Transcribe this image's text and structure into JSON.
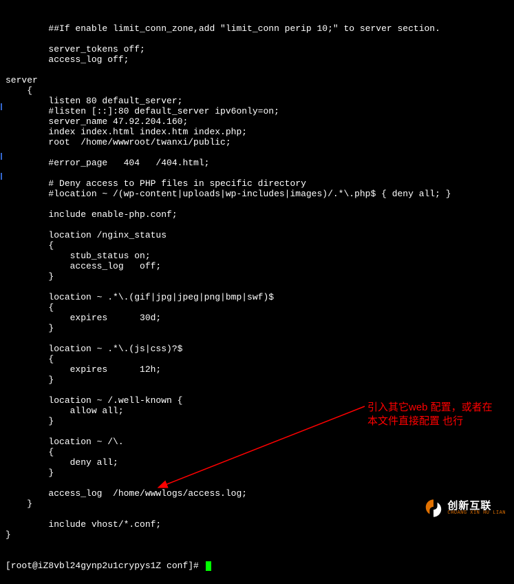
{
  "code_lines": [
    "        ##If enable limit_conn_zone,add \"limit_conn perip 10;\" to server section.",
    "",
    "        server_tokens off;",
    "        access_log off;",
    "",
    "server",
    "    {",
    "        listen 80 default_server;",
    "        #listen [::]:80 default_server ipv6only=on;",
    "        server_name 47.92.204.160;",
    "        index index.html index.htm index.php;",
    "        root  /home/wwwroot/twanxi/public;",
    "",
    "        #error_page   404   /404.html;",
    "",
    "        # Deny access to PHP files in specific directory",
    "        #location ~ /(wp-content|uploads|wp-includes|images)/.*\\.php$ { deny all; }",
    "",
    "        include enable-php.conf;",
    "",
    "        location /nginx_status",
    "        {",
    "            stub_status on;",
    "            access_log   off;",
    "        }",
    "",
    "        location ~ .*\\.(gif|jpg|jpeg|png|bmp|swf)$",
    "        {",
    "            expires      30d;",
    "        }",
    "",
    "        location ~ .*\\.(js|css)?$",
    "        {",
    "            expires      12h;",
    "        }",
    "",
    "        location ~ /.well-known {",
    "            allow all;",
    "        }",
    "",
    "        location ~ /\\.",
    "        {",
    "            deny all;",
    "        }",
    "",
    "        access_log  /home/wwwlogs/access.log;",
    "    }",
    "",
    "        include vhost/*.conf;",
    "}"
  ],
  "prompt": "[root@iZ8vbl24gynp2u1crypys1Z conf]# ",
  "annotation": {
    "line1": "引入其它web 配置，或者在",
    "line2": "本文件直接配置 也行"
  },
  "logo": {
    "cn": "创新互联",
    "en": "CHUANG XIN HU LIAN"
  }
}
